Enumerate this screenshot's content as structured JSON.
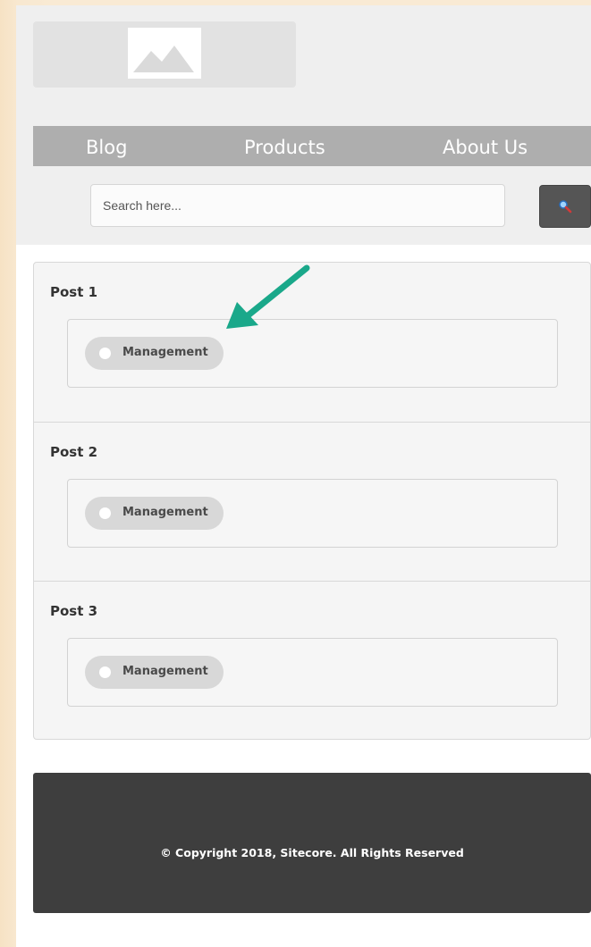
{
  "header": {
    "logo_icon": "image-placeholder-icon",
    "nav": [
      "Blog",
      "Products",
      "About Us"
    ],
    "search": {
      "placeholder": "Search here...",
      "value": "",
      "button_icon": "magnifier-icon"
    }
  },
  "posts": [
    {
      "title": "Post 1",
      "tags": [
        "Management"
      ]
    },
    {
      "title": "Post 2",
      "tags": [
        "Management"
      ]
    },
    {
      "title": "Post 3",
      "tags": [
        "Management"
      ]
    }
  ],
  "annotation": {
    "icon": "pointer-arrow-icon",
    "color": "#1aa88a"
  },
  "footer": {
    "copyright": "© Copyright 2018, Sitecore. All Rights Reserved"
  },
  "colors": {
    "nav_bg": "#aeaeae",
    "footer_bg": "#3e3e3e",
    "search_button_bg": "#555555",
    "tag_bg": "#d8d8d8"
  }
}
